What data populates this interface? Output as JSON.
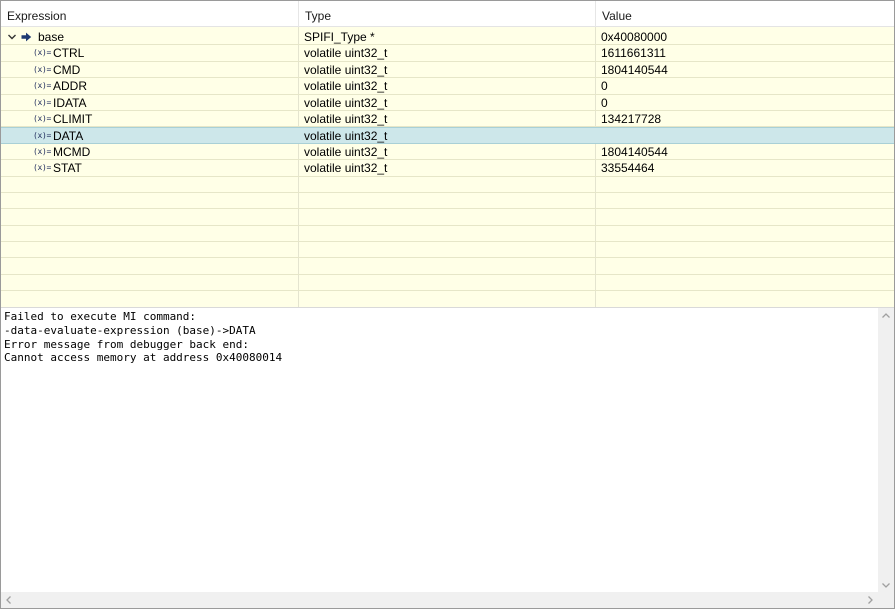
{
  "table": {
    "headers": {
      "expression": "Expression",
      "type": "Type",
      "value": "Value"
    },
    "root": {
      "name": "base",
      "type": "SPIFI_Type *",
      "value": "0x40080000",
      "expanded": true
    },
    "children": [
      {
        "icon": "(x)=",
        "name": "CTRL",
        "type": "volatile uint32_t",
        "value": "1611661311"
      },
      {
        "icon": "(x)=",
        "name": "CMD",
        "type": "volatile uint32_t",
        "value": "1804140544"
      },
      {
        "icon": "(x)=",
        "name": "ADDR",
        "type": "volatile uint32_t",
        "value": "0"
      },
      {
        "icon": "(x)=",
        "name": "IDATA",
        "type": "volatile uint32_t",
        "value": "0"
      },
      {
        "icon": "(x)=",
        "name": "CLIMIT",
        "type": "volatile uint32_t",
        "value": "134217728"
      },
      {
        "icon": "(x)=",
        "name": "DATA",
        "type": "volatile uint32_t",
        "value": ""
      },
      {
        "icon": "(x)=",
        "name": "MCMD",
        "type": "volatile uint32_t",
        "value": "1804140544"
      },
      {
        "icon": "(x)=",
        "name": "STAT",
        "type": "volatile uint32_t",
        "value": "33554464"
      }
    ],
    "selected_row": "DATA"
  },
  "detail": {
    "lines": [
      "Failed to execute MI command:",
      "-data-evaluate-expression (base)->DATA",
      "Error message from debugger back end:",
      "Cannot access memory at address 0x40080014"
    ]
  },
  "colors": {
    "row_background": "#ffffe7",
    "selection": "#cde7ea",
    "expand_arrow": "#1f3a72"
  }
}
